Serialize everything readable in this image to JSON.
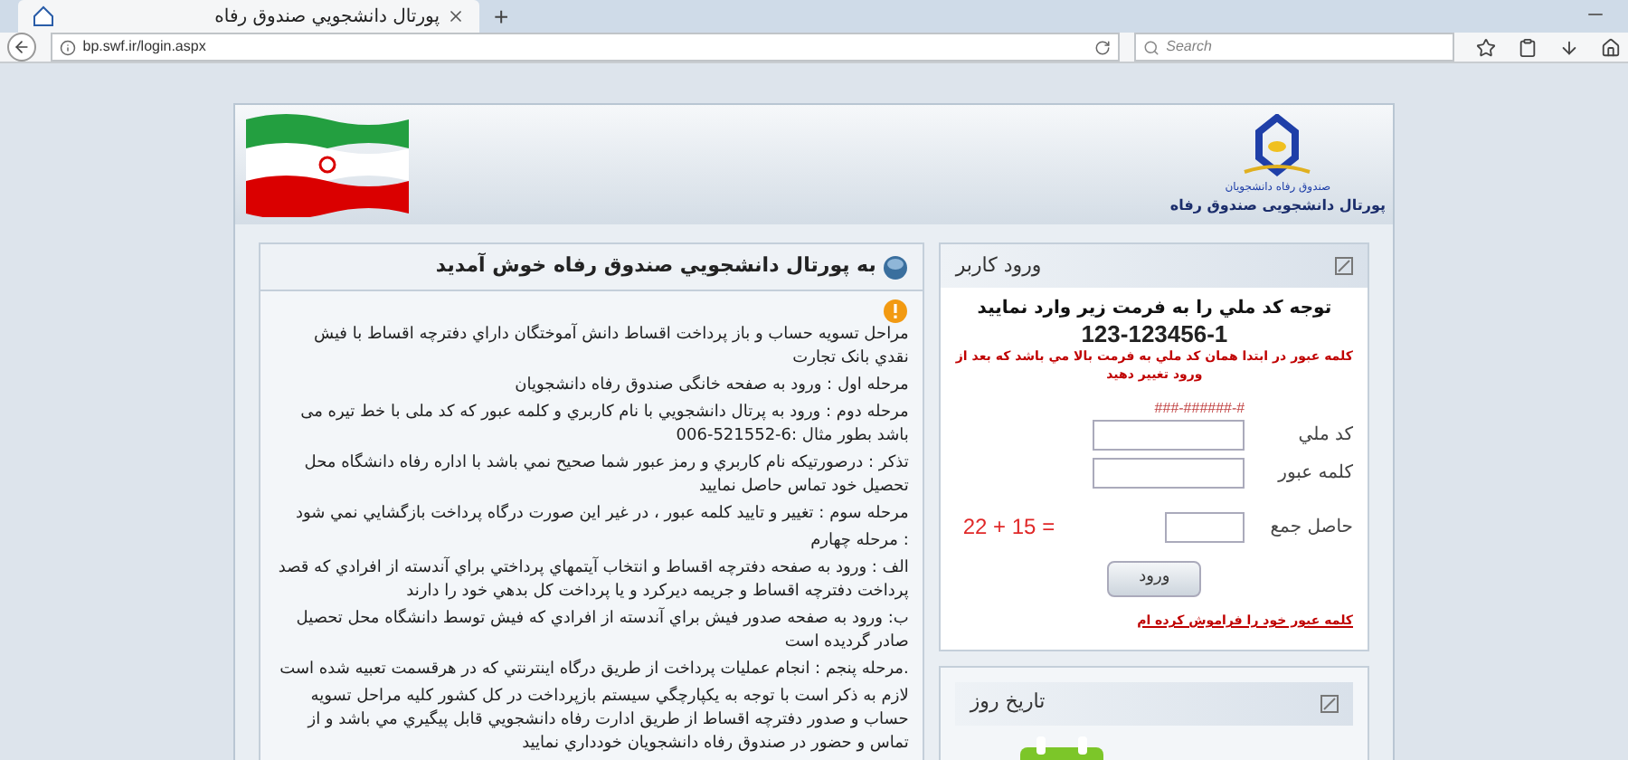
{
  "browser": {
    "tab_title": "پورتال دانشجويي صندوق رفاه",
    "new_tab": "+",
    "url": "bp.swf.ir/login.aspx",
    "search": {
      "placeholder": "Search"
    }
  },
  "header": {
    "logo_caption": "صندوق رفاه دانشجويان",
    "portal_name": "پورتال دانشجويی صندوق رفاه"
  },
  "welcome": {
    "title": "به پورتال دانشجويي صندوق رفاه خوش آمديد",
    "paragraphs": [
      "مراحل تسويه حساب و باز پرداخت اقساط دانش آموختگان داراي دفترچه اقساط با فيش نقدي بانک تجارت",
      "مرحله اول : ورود به صفحه خانگی صندوق رفاه دانشجویان",
      "مرحله دوم : ورود به پرتال دانشجويي با نام کاربري و کلمه عبور که کد ملی با خط تيره می باشد بطور مثال :6-521552-006",
      "تذکر : درصورتيکه نام کاربري و رمز عبور شما صحيح نمي باشد با اداره رفاه دانشگاه محل تحصيل خود تماس حاصل نماييد",
      "مرحله سوم : تغيير و تاييد کلمه عبور ، در غير اين صورت درگاه پرداخت بازگشايي نمي شود",
      ": مرحله چهارم",
      "الف : ورود به صفحه دفترچه اقساط و انتخاب آيتمهاي پرداختي براي آندسته از افرادي که قصد پرداخت دفترچه اقساط و جريمه ديرکرد و يا پرداخت کل بدهي خود را دارند",
      "ب: ورود به صفحه صدور فيش براي آندسته از افرادي که فيش توسط دانشگاه محل تحصيل صادر گرديده است",
      ".مرحله پنجم : انجام عمليات پرداخت از طريق درگاه اينترنتي که در هرقسمت تعبيه شده است",
      "لازم به ذکر است با توجه به يکپارچگي سيستم بازپرداخت در کل کشور کليه مراحل تسويه حساب و صدور دفترچه اقساط از طريق ادارت رفاه دانشجويي قابل پيگيري مي باشد و از تماس و حضور در صندوق رفاه دانشجويان خودداري نماييد"
    ]
  },
  "login": {
    "title": "ورود کاربر",
    "notice": "توجه کد ملي را به فرمت زير وارد نماييد",
    "format_example": "123-123456-1",
    "warning": "کلمه عبور  در ابتدا همان کد ملي به  فرمت بالا مي باشد که بعد از ورود تغيير دهيد",
    "national_id_hint": "###-######-#",
    "fields": [
      {
        "label": "کد ملي"
      },
      {
        "label": "کلمه عبور"
      }
    ],
    "captcha": {
      "label": "حاصل جمع",
      "question": "22 + 15 ="
    },
    "submit": "ورود",
    "forgot_link": "کلمه عبور خود را فراموش کرده ام"
  },
  "date_panel": {
    "title": "تاريخ روز"
  }
}
